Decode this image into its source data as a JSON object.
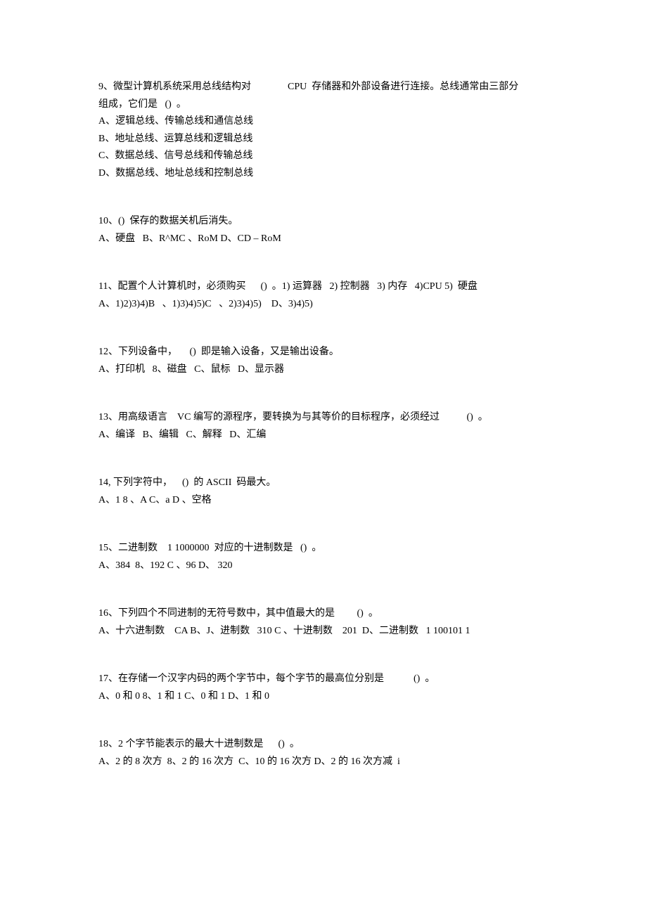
{
  "questions": [
    {
      "num": "9",
      "stem_a": "9、微型计算机系统采用总线结构对",
      "stem_b": "CPU  存储器和外部设备进行连接。总线通常由三部分",
      "stem_c": "组成，它们是   ()  。",
      "options": [
        "A、逻辑总线、传输总线和通信总线",
        "B、地址总线、运算总线和逻辑总线",
        "C、数据总线、信号总线和传输总线",
        "D、数据总线、地址总线和控制总线"
      ]
    },
    {
      "num": "10",
      "stem": "10、()  保存的数据关机后消失。",
      "options_line": "A、硬盘   B、R^MC 、RoM D、CD – RoM"
    },
    {
      "num": "11",
      "stem": "11、配置个人计算机时，必须购买      ()  。1) 运算器   2) 控制器   3) 内存   4)CPU 5)  硬盘",
      "options_line": "A、1)2)3)4)B   、1)3)4)5)C   、2)3)4)5)    D、3)4)5)"
    },
    {
      "num": "12",
      "stem": "12、下列设备中，     ()  即是输入设备，又是输出设备。",
      "options_line": "A、打印机   8、磁盘   C、鼠标   D、显示器"
    },
    {
      "num": "13",
      "stem": "13、用高级语言    VC 编写的源程序，要转换为与其等价的目标程序，必须经过           ()  。",
      "options_line": "A、编译   B、编辑   C、解释   D、汇编"
    },
    {
      "num": "14",
      "stem": "14, 下列字符中，    ()  的 ASCII  码最大。",
      "options_line": "A、1 8 、A C、a D 、空格"
    },
    {
      "num": "15",
      "stem": "15、二进制数    1 1000000  对应的十进制数是   ()  。",
      "options_line": "A、384  8、192 C 、96 D、 320"
    },
    {
      "num": "16",
      "stem": "16、下列四个不同进制的无符号数中，其中值最大的是         ()  。",
      "options_line": "A、十六进制数    CA B、J、进制数   310 C 、十进制数    201  D、二进制数   1 100101 1"
    },
    {
      "num": "17",
      "stem": "17、在存储一个汉字内码的两个字节中，每个字节的最高位分别是            ()  。",
      "options_line": "A、0 和 0 8、1 和 1 C、0 和 1 D、1 和 0"
    },
    {
      "num": "18",
      "stem": "18、2 个字节能表示的最大十进制数是      ()  。",
      "options_line": "A、2 的 8 次方  8、2 的 16 次方  C、10 的 16 次方 D、2 的 16 次方减  i"
    }
  ]
}
